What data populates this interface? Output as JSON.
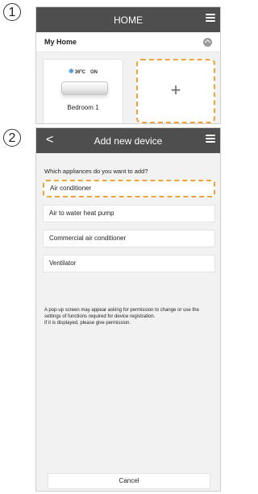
{
  "steps": {
    "one": "1",
    "two": "2"
  },
  "screen1": {
    "title": "HOME",
    "home_name": "My Home",
    "device": {
      "temp": "36ºC",
      "state": "ON",
      "name": "Bedroom 1",
      "mode_icon": "snowflake-icon"
    },
    "add_button": "+"
  },
  "screen2": {
    "back": "<",
    "title": "Add new device",
    "question": "Which appliances do you want to add?",
    "options": [
      "Air conditioner",
      "Air to water heat pump",
      "Commercial air conditioner",
      "Ventilator"
    ],
    "info_line1": "A pop-up screen may appear asking for permission to change or use the settings of functions required for device registration.",
    "info_line2": "If it is displayed, please give permission.",
    "cancel": "Cancel"
  },
  "colors": {
    "header": "#4e4e4e",
    "highlight": "#f0a33a",
    "background": "#f2f2f2"
  }
}
